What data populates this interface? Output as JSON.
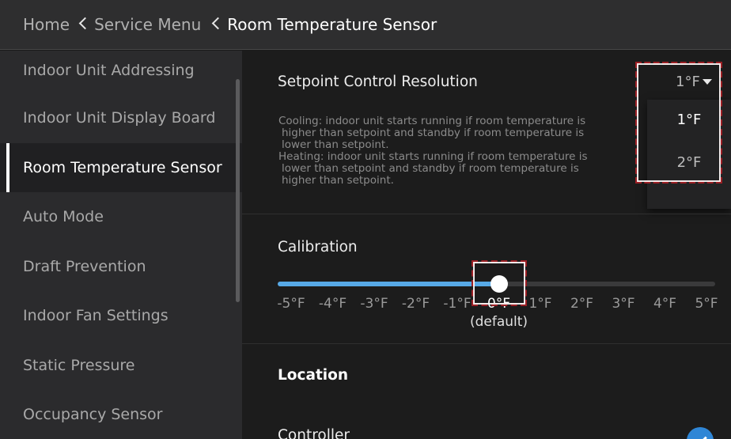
{
  "header": {
    "crumbs": [
      "Home",
      "Service Menu",
      "Room Temperature Sensor"
    ]
  },
  "sidebar": {
    "items": [
      {
        "label": "Indoor Unit Addressing"
      },
      {
        "label": "Indoor Unit Display Board"
      },
      {
        "label": "Room Temperature Sensor",
        "active": true
      },
      {
        "label": "Auto Mode"
      },
      {
        "label": "Draft Prevention"
      },
      {
        "label": "Indoor Fan Settings"
      },
      {
        "label": "Static Pressure"
      },
      {
        "label": "Occupancy Sensor"
      }
    ]
  },
  "setpoint": {
    "title": "Setpoint Control Resolution",
    "value": "1°F",
    "options": [
      "1°F",
      "2°F"
    ],
    "description": [
      "Cooling: indoor unit starts running if room temperature is",
      "higher than setpoint and standby if room temperature is",
      "lower than setpoint.",
      "Heating: indoor unit starts running if room temperature is",
      "lower than setpoint and standby if room temperature is",
      "higher than setpoint."
    ]
  },
  "calibration": {
    "title": "Calibration",
    "ticks": [
      "-5°F",
      "-4°F",
      "-3°F",
      "-2°F",
      "-1°F",
      "0°F",
      "1°F",
      "2°F",
      "3°F",
      "4°F",
      "5°F"
    ],
    "value_index": 5,
    "default_note": "(default)"
  },
  "location": {
    "title": "Location",
    "controller_label": "Controller"
  },
  "colors": {
    "accent": "#57a9e6",
    "highlight": "#9b1f24",
    "check": "#2f86d6"
  }
}
